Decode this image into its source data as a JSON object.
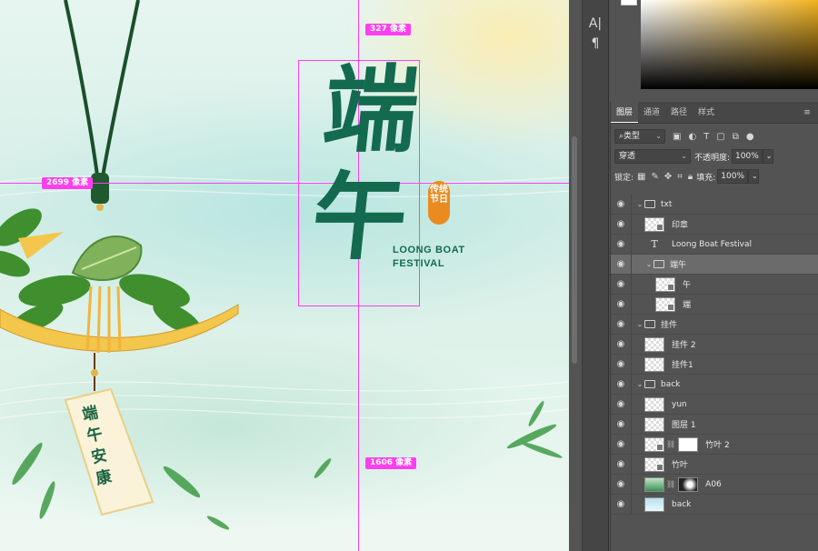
{
  "canvas": {
    "artwork": {
      "title_cn": "端午",
      "title_en_line1": "LOONG BOAT",
      "title_en_line2": "FESTIVAL",
      "seal_text": "传统节日",
      "tag_text": "端午安康"
    },
    "measurements": {
      "top": "327 像素",
      "left": "2699 像素",
      "bottom": "1606 像素"
    }
  },
  "tools": {
    "items": [
      {
        "name": "character-panel-icon",
        "glyph": "A|"
      },
      {
        "name": "paragraph-panel-icon",
        "glyph": "¶"
      }
    ]
  },
  "layers_panel": {
    "tabs": [
      "图层",
      "通道",
      "路径",
      "样式"
    ],
    "active_tab": "图层",
    "filter": {
      "label": "类型"
    },
    "blend_mode": "穿透",
    "opacity_label": "不透明度:",
    "opacity_value": "100%",
    "lock_label": "锁定:",
    "fill_label": "填充:",
    "fill_value": "100%",
    "layers": [
      {
        "name": "txt",
        "kind": "group",
        "indent": 0,
        "open": true
      },
      {
        "name": "印章",
        "kind": "smart",
        "indent": 1
      },
      {
        "name": "Loong Boat Festival",
        "kind": "text",
        "indent": 1
      },
      {
        "name": "端午",
        "kind": "group",
        "indent": 1,
        "open": true,
        "selected": true
      },
      {
        "name": "午",
        "kind": "smart",
        "indent": 2
      },
      {
        "name": "端",
        "kind": "smart",
        "indent": 2
      },
      {
        "name": "挂件",
        "kind": "group",
        "indent": 0,
        "open": true
      },
      {
        "name": "挂件 2",
        "kind": "pixel",
        "indent": 1
      },
      {
        "name": "挂件1",
        "kind": "pixel",
        "indent": 1
      },
      {
        "name": "back",
        "kind": "group",
        "indent": 0,
        "open": true
      },
      {
        "name": "yun",
        "kind": "pixel",
        "indent": 1
      },
      {
        "name": "图层 1",
        "kind": "pixel",
        "indent": 1
      },
      {
        "name": "竹叶 2",
        "kind": "smart-mask",
        "indent": 1
      },
      {
        "name": "竹叶",
        "kind": "smart",
        "indent": 1
      },
      {
        "name": "A06",
        "kind": "green-mask",
        "indent": 1
      },
      {
        "name": "back",
        "kind": "sky",
        "indent": 1
      }
    ]
  },
  "colors": {
    "guide": "#ff3ef0",
    "title_green": "#146a4f",
    "seal_orange": "#ea8b1f",
    "panel_bg": "#535353"
  }
}
